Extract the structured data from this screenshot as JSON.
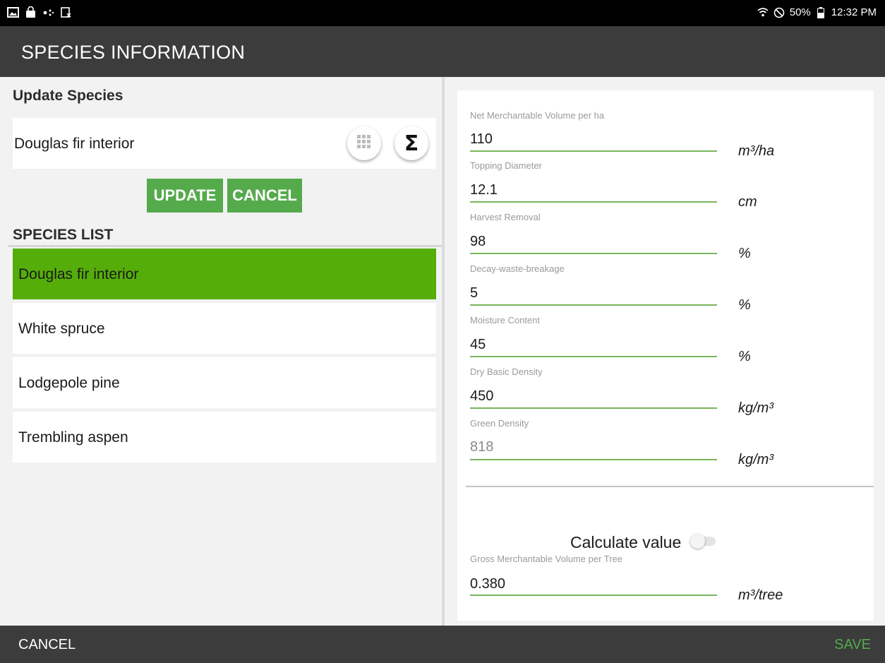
{
  "status_bar": {
    "left_icons": [
      "gallery-icon",
      "shopping-bag-icon",
      "dots-icon",
      "clipboard-icon"
    ],
    "battery": "50%",
    "time": "12:32 PM"
  },
  "app_bar": {
    "title": "SPECIES INFORMATION"
  },
  "update_section": {
    "title": "Update Species",
    "selected_species": "Douglas fir interior",
    "update_label": "UPDATE",
    "cancel_label": "CANCEL"
  },
  "species_list": {
    "title": "SPECIES LIST",
    "items": [
      {
        "label": "Douglas fir interior",
        "selected": true
      },
      {
        "label": "White spruce",
        "selected": false
      },
      {
        "label": "Lodgepole pine",
        "selected": false
      },
      {
        "label": "Trembling aspen",
        "selected": false
      }
    ]
  },
  "fields": [
    {
      "label": "Net Merchantable Volume per ha",
      "value": "110",
      "unit": "m³/ha"
    },
    {
      "label": "Topping Diameter",
      "value": "12.1",
      "unit": "cm"
    },
    {
      "label": "Harvest Removal",
      "value": "98",
      "unit": "%"
    },
    {
      "label": "Decay-waste-breakage",
      "value": "5",
      "unit": "%"
    },
    {
      "label": "Moisture Content",
      "value": "45",
      "unit": "%"
    },
    {
      "label": "Dry Basic Density",
      "value": "450",
      "unit": "kg/m³"
    },
    {
      "label": "Green Density",
      "value": "818",
      "unit": "kg/m³"
    }
  ],
  "calculate": {
    "label": "Calculate value",
    "enabled": false,
    "field": {
      "label": "Gross Merchantable Volume per Tree",
      "value": "0.380",
      "unit": "m³/tree"
    }
  },
  "bottom_bar": {
    "cancel_label": "CANCEL",
    "save_label": "SAVE"
  },
  "colors": {
    "accent_green": "#55aa4c",
    "selected_green": "#55ad09",
    "bar_dark": "#3c3c3c"
  }
}
